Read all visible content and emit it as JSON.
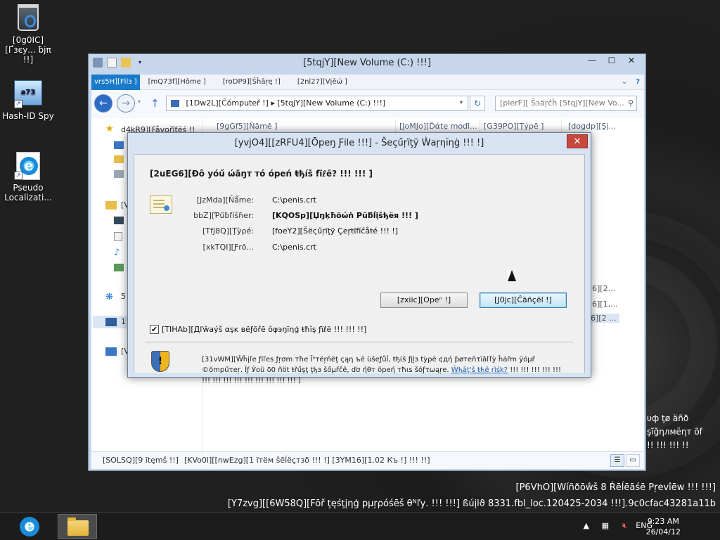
{
  "desktop": {
    "icons": [
      {
        "label": "[0g0IC][Ґзєу... ƀјπ !!]"
      },
      {
        "label": "Hash-ID Spy"
      },
      {
        "label": "Pseudo Localizati..."
      }
    ],
    "edge_lines": [
      "υф ţø äñð",
      "şĩğηлмёηт õf",
      "!! !!! !!! !!"
    ],
    "watermark": [
      "[P6VhO][Wíñðōŵš 8 Ŕēĺēāśē Pŗevîēw !!! !!!]",
      "[Y7zvg][[6W58Q][Fōř ţęśţįηģ pµŗρóśēš θᴺľу. !!! !!!] ßúįlϑ 8331.fbl_loc.120425-2034 !!!].9c0cfac43281a11b"
    ]
  },
  "explorer": {
    "title": "[5tqjY][New Volume (C:) !!!]",
    "ribbon_tabs": [
      "vrs5H][Fìlз ]",
      "[mQ73f][Hôme ]",
      "[roDP9][Šĥāŗę !]",
      "[2nl27][Vįēώ ]"
    ],
    "address": "[1Dw2L][Ĉόmрutеř !]   ▸   [5tqjY][New Volume (C:) !!!]",
    "search_placeholder": "[plerF][ Šэäŗĉĥ [5tqjY][New Vo...",
    "nav_items": [
      "d4kR9][Fåvořîťēś !!",
      "[V",
      "5",
      "1",
      "[V"
    ],
    "columns": [
      "[9gGf5][Ňāmē ]",
      "[JoMJo][Ďάtẹ moďi...",
      "[G39PO][Ţýρē ]",
      "[dogdp][Şį..."
    ],
    "right_fragments": [
      "6][2...",
      "6][1,...",
      "6][2 ..."
    ],
    "status": {
      "items": "[SOLSQ][9 ītęmš !!]",
      "selected": "[KVo0l][[nwEzg][1 ïтём šēĺёçтзδ !!! !] [3YM16][1.02 Къ !] !!! !!]"
    }
  },
  "dialog": {
    "title": "[yvjO4][[zRFU4][Ōpeŋ Ƒilе !!!] - Šеçűŗïţÿ Ẁаŗηĭηġ !!! !]",
    "question": "[2uEG6][Ðô yóű ώäŋт тó óреń ŧђíš fïℓē? !!! !!! ]",
    "fields": [
      {
        "label": "[JzMda][Ñǻme:",
        "value": "C:\\penis.crt",
        "bold": false
      },
      {
        "label": "bbZ][Ƥűƀľíšɦеr:",
        "value": "[KQOSp][Џŋķħöώṅ Pũƃĺįšђёя !!! ]",
        "bold": true
      },
      {
        "label": "[TfJ8Q][Ţỳρé:",
        "value": "[foeY2][Šёςűŗīţÿ Çeŗŧīfĭĉåŧé !!! !]",
        "bold": false
      },
      {
        "label": "[xkTQI][Ƒrō...",
        "value": "C:\\penis.crt",
        "bold": false
      }
    ],
    "open_button": "[zxiic][Opeⁿ !]",
    "cancel_button": "[J0jc][Ĉāñçēl !]",
    "checkbox_label": "[TIHAb][Дľŵаýš αşĸ вёƒõřē ŏφэŋīηģ ŧħĭş ƒïℓё !!! !!! !!]",
    "checkbox_checked": true,
    "warning_text": "[31vWM][Ŵĥįľе ƒíľеѕ ƒŗσm тħе Ĭⁿтёŗńёţ ςąη ъē ùšеƒůĺ, ŧђίš ƒįļз tỳρё ¢дή ƥøтеñτïâľľỳ ĥářm ÿόμř ©ŏmрűτеŗ. Ĭƒ Ўоü δ0 ñöt ŧřűşţ ţђз šőμřčё, ďσ ήθт öреή тħιѕ šόƒτωąŗе.",
    "warning_link": "Ŵђāţ'š ŧћē ŗìśķ?",
    "warning_tail": "!!! !!! !!! !!! !!! !!! !!! !!! !!! !!! !!! !!! !!! !!! ]"
  },
  "taskbar": {
    "language": "ENG",
    "time": "9:23 AM",
    "date": "26/04/12"
  },
  "colors": {
    "accent": "#1979ca",
    "close_red": "#c9483b",
    "link": "#1a5fb4"
  }
}
